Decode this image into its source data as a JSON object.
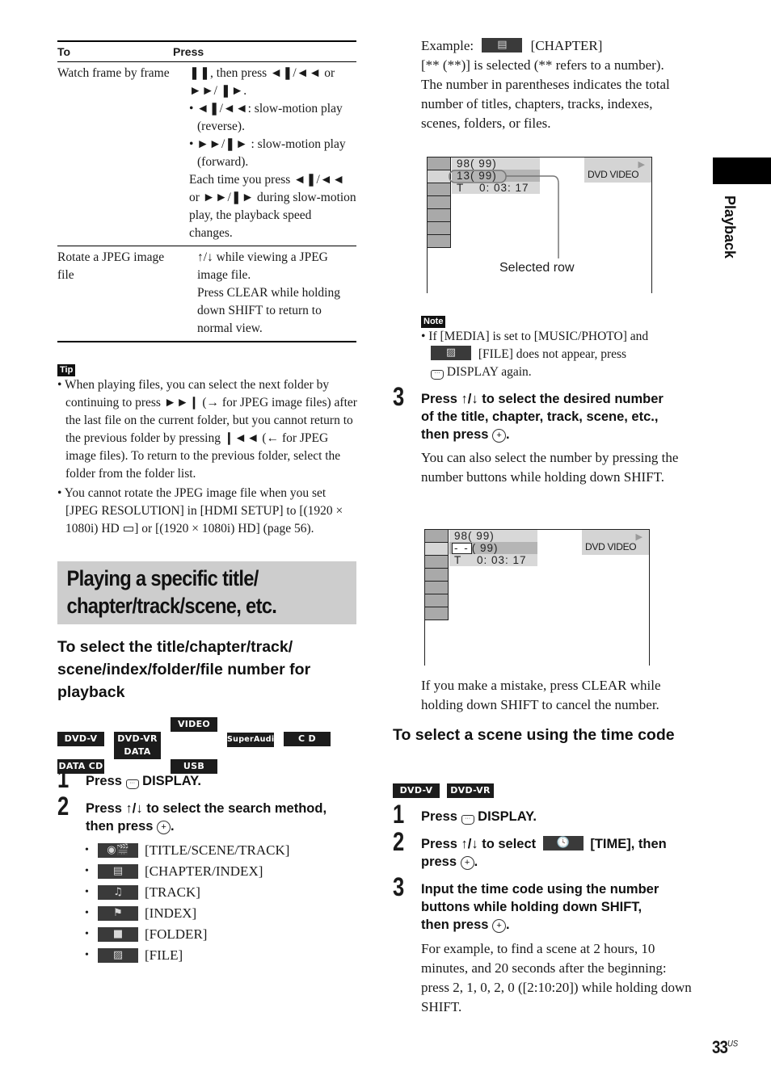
{
  "table": {
    "header": {
      "to": "To",
      "press": "Press"
    },
    "rows": [
      {
        "to": "Watch frame by frame",
        "press": [
          "❚❚, then press ◄❚/◄◄ or ►►/ ❚►.",
          "• ◄❚/◄◄: slow-motion play (reverse).",
          "• ►►/❚► : slow-motion play (forward).",
          "Each time you press ◄❚/◄◄ or ►►/❚► during slow-motion play, the playback speed changes."
        ]
      },
      {
        "to": "Rotate a JPEG image file",
        "press": [
          "↑/↓ while viewing a JPEG image file.",
          "Press CLEAR while holding down SHIFT to return to normal view."
        ]
      }
    ]
  },
  "tip": {
    "label": "Tip",
    "items": [
      "• When playing files, you can select the next folder by continuing to press ►►❙ (→ for JPEG image files) after the last file on the current folder, but you cannot return to the previous folder by pressing ❙◄◄ (← for JPEG image files). To return to the previous folder, select the folder from the folder list.",
      "• You cannot rotate the JPEG image file when you set [JPEG RESOLUTION] in [HDMI SETUP] to [(1920 × 1080i) HD ▭] or [(1920 × 1080i) HD] (page 56)."
    ]
  },
  "section_title": "Playing a specific title/ chapter/track/scene, etc.",
  "subsection1": {
    "title": "To select the title/chapter/track/ scene/index/folder/file number for playback",
    "media": [
      "DVD-V",
      "DVD-VR",
      "VIDEO CD",
      "SuperAudioCD",
      "C D",
      "DATA CD",
      "DATA DVD",
      "USB"
    ],
    "steps": [
      {
        "num": "1",
        "pre": "Press",
        "post": "DISPLAY."
      },
      {
        "num": "2",
        "line1": "Press ↑/↓ to select the search method,",
        "line2": "then press",
        "line2_end": "."
      },
      {
        "num": "3",
        "line1": "Press ↑/↓ to select the desired number",
        "line2": "of the title, chapter, track, scene, etc.,",
        "line3": "then press",
        "line3_end": "."
      }
    ],
    "methods": [
      {
        "icon": "title-scene-track-icon",
        "label": "[TITLE/SCENE/TRACK]"
      },
      {
        "icon": "chapter-index-icon",
        "label": "[CHAPTER/INDEX]"
      },
      {
        "icon": "track-icon",
        "label": "[TRACK]"
      },
      {
        "icon": "index-icon",
        "label": "[INDEX]"
      },
      {
        "icon": "folder-icon",
        "label": "[FOLDER]"
      },
      {
        "icon": "file-icon",
        "label": "[FILE]"
      }
    ],
    "example_label": "Example:",
    "example_value": "[CHAPTER]",
    "example_lines": [
      "[** (**)] is selected (** refers to a number).",
      "The number in parentheses indicates the total number of titles, chapters, tracks, indexes, scenes, folders, or files."
    ],
    "osd1": {
      "rows": [
        "98( 99)",
        "13( 99)",
        "T    0: 03: 17"
      ],
      "mode": "DVD VIDEO",
      "callout": "Selected row"
    },
    "note": {
      "label": "Note",
      "line1": "• If [MEDIA] is set to [MUSIC/PHOTO] and",
      "line2": "[FILE] does not appear, press",
      "line3": "DISPLAY again."
    },
    "step3_body": "You can also select the number by pressing the number buttons while holding down SHIFT.",
    "osd2": {
      "rows": [
        "98( 99)",
        "( 99)",
        "T    0: 03: 17"
      ],
      "input": "- -",
      "mode": "DVD VIDEO"
    },
    "mistake_text": "If you make a mistake, press CLEAR while holding down SHIFT to cancel the number."
  },
  "subsection2": {
    "title": "To select a scene using the time code",
    "media": [
      "DVD-V",
      "DVD-VR"
    ],
    "steps": [
      {
        "num": "1",
        "pre": "Press",
        "post": "DISPLAY."
      },
      {
        "num": "2",
        "pre": "Press ↑/↓ to select",
        "post": "[TIME], then",
        "line2": "press",
        "line2_end": "."
      },
      {
        "num": "3",
        "line1": "Input the time code using the number",
        "line2": "buttons while holding down SHIFT,",
        "line3": "then press",
        "line3_end": "."
      }
    ],
    "example_text": "For example, to find a scene at 2 hours, 10 minutes, and 20 seconds after the beginning: press 2, 1, 0, 2, 0 ([2:10:20]) while holding down SHIFT."
  },
  "side_tab": "Playback",
  "page": {
    "number": "33",
    "suffix": "US"
  }
}
